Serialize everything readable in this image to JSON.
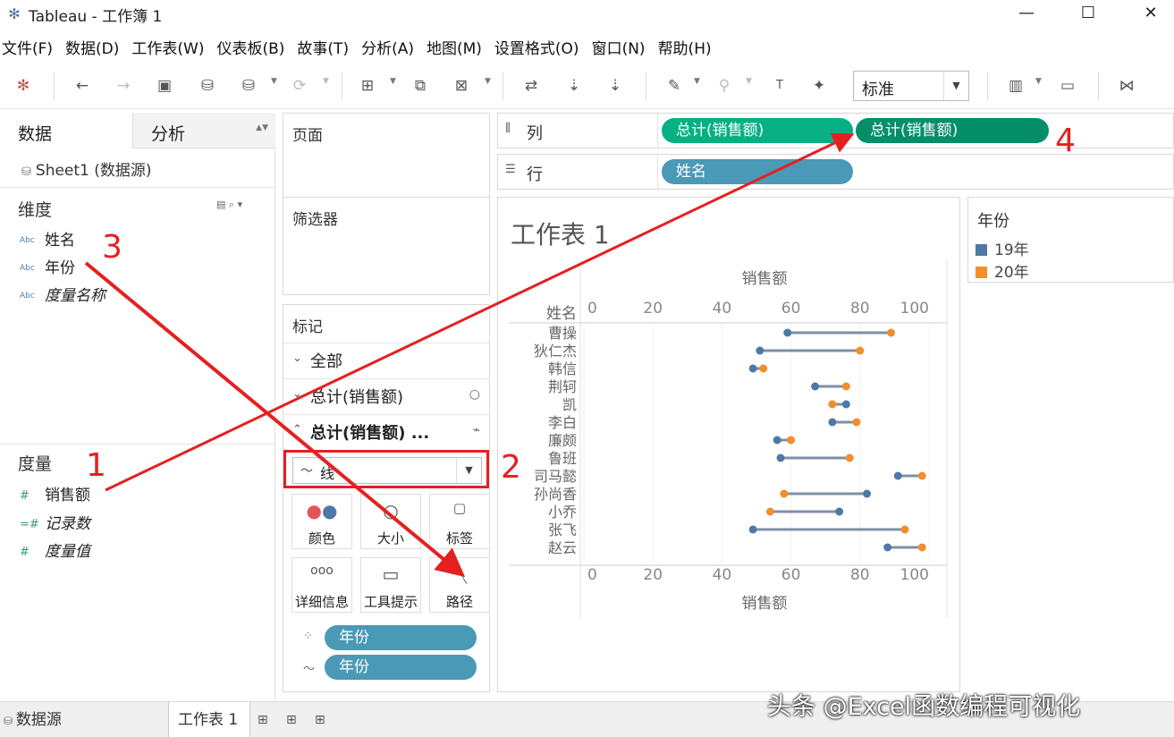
{
  "window": {
    "title": "Tableau - 工作簿 1",
    "app_icon": "tableau-logo-icon",
    "min": "—",
    "max": "☐",
    "close": "✕"
  },
  "menu": [
    "文件(F)",
    "数据(D)",
    "工作表(W)",
    "仪表板(B)",
    "故事(T)",
    "分析(A)",
    "地图(M)",
    "设置格式(O)",
    "窗口(N)",
    "帮助(H)"
  ],
  "toolbar": {
    "fit_value": "标准"
  },
  "data_pane": {
    "tab_data": "数据",
    "tab_analysis": "分析",
    "datasource": "Sheet1 (数据源)",
    "dimensions_title": "维度",
    "dimensions": [
      {
        "type": "Abc",
        "name": "姓名"
      },
      {
        "type": "Abc",
        "name": "年份"
      },
      {
        "type": "Abc",
        "name": "度量名称"
      }
    ],
    "measures_title": "度量",
    "measures": [
      {
        "type": "#",
        "name": "销售额"
      },
      {
        "type": "=#",
        "name": "记录数"
      },
      {
        "type": "#",
        "name": "度量值"
      }
    ]
  },
  "cards": {
    "pages": "页面",
    "filters": "筛选器",
    "marks": "标记",
    "marks_all": "全部",
    "marks_measure1": "总计(销售额)",
    "marks_measure2": "总计(销售额) ...",
    "mark_type": "线",
    "buttons": {
      "color": "颜色",
      "size": "大小",
      "label": "标签",
      "detail": "详细信息",
      "tooltip": "工具提示",
      "path": "路径"
    },
    "pill_color": "年份",
    "pill_path": "年份"
  },
  "shelves": {
    "columns_label": "列",
    "rows_label": "行",
    "columns_pills": [
      "总计(销售额)",
      "总计(销售额)"
    ],
    "rows_pills": [
      "姓名"
    ]
  },
  "sheet": {
    "title": "工作表 1"
  },
  "legend": {
    "title": "年份",
    "items": [
      {
        "label": "19年",
        "color": "#4e79a7"
      },
      {
        "label": "20年",
        "color": "#f28e2b"
      }
    ]
  },
  "chart_data": {
    "type": "scatter",
    "subtype": "dumbbell",
    "xlabel": "销售额",
    "ylabel": "姓名",
    "xlim": [
      0,
      100
    ],
    "x_ticks": [
      0,
      20,
      40,
      60,
      80,
      100
    ],
    "categories": [
      "曹操",
      "狄仁杰",
      "韩信",
      "荆轲",
      "凯",
      "李白",
      "廉颇",
      "鲁班",
      "司马懿",
      "孙尚香",
      "小乔",
      "张飞",
      "赵云"
    ],
    "series": [
      {
        "name": "19年",
        "color": "#4e79a7",
        "values": [
          59,
          51,
          49,
          67,
          76,
          72,
          56,
          57,
          91,
          82,
          74,
          49,
          88
        ]
      },
      {
        "name": "20年",
        "color": "#f28e2b",
        "values": [
          89,
          80,
          52,
          76,
          72,
          79,
          60,
          77,
          98,
          58,
          54,
          93,
          98
        ]
      }
    ],
    "connector_color": "#7f8fa6"
  },
  "bottom": {
    "datasource_tab": "数据源",
    "sheet_tab": "工作表 1"
  },
  "watermark": "头条 @Excel函数编程可视化",
  "annotations": [
    "1",
    "2",
    "3",
    "4"
  ],
  "colors": {
    "annotation": "#e52020",
    "dimension_pill": "#4a99b6",
    "measure_pill": "#05b183"
  }
}
